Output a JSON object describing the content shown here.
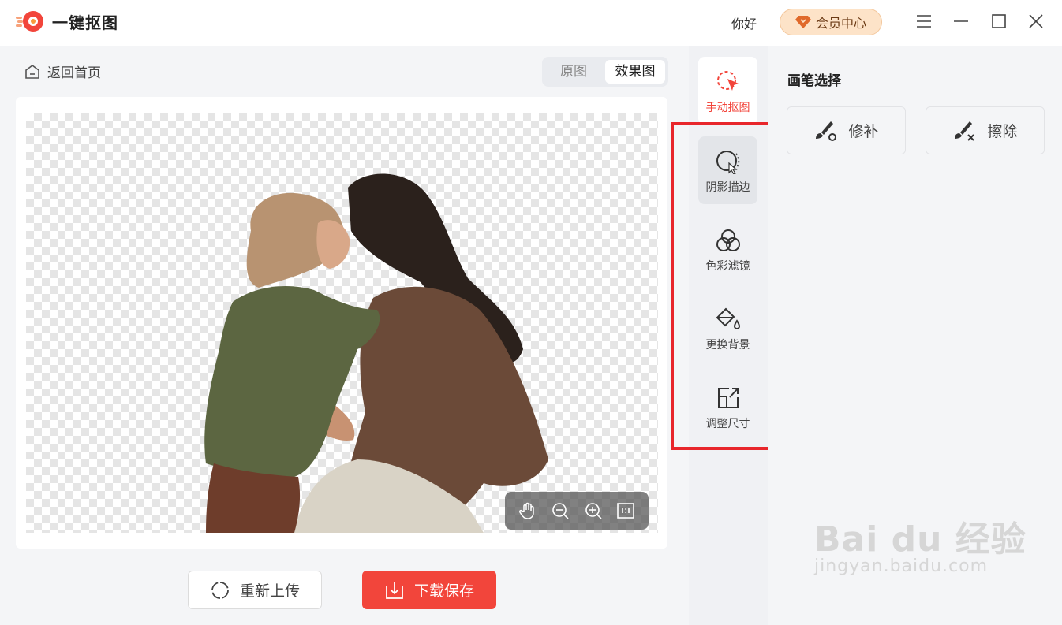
{
  "app": {
    "title": "一键抠图"
  },
  "header": {
    "greeting": "你好",
    "vip_label": "会员中心"
  },
  "window_controls": [
    "menu-icon",
    "minimize-icon",
    "maximize-icon",
    "close-icon"
  ],
  "toolbar": {
    "back_label": "返回首页",
    "view_tabs": [
      "原图",
      "效果图"
    ],
    "active_tab": "效果图"
  },
  "canvas": {
    "zoom_tools": [
      "hand-icon",
      "zoom-out-icon",
      "zoom-in-icon",
      "fit-icon"
    ]
  },
  "actions": {
    "reupload_label": "重新上传",
    "download_label": "下载保存"
  },
  "side_tools": [
    {
      "label": "手动抠图",
      "icon": "manual-cutout-icon",
      "active": true
    },
    {
      "label": "阴影描边",
      "icon": "shadow-stroke-icon"
    },
    {
      "label": "色彩滤镜",
      "icon": "color-filter-icon"
    },
    {
      "label": "更换背景",
      "icon": "paint-bucket-icon"
    },
    {
      "label": "调整尺寸",
      "icon": "resize-icon"
    }
  ],
  "panel": {
    "title": "画笔选择",
    "buttons": [
      {
        "label": "修补",
        "icon": "brush-repair-icon"
      },
      {
        "label": "擦除",
        "icon": "brush-erase-icon"
      }
    ]
  },
  "watermark": {
    "brand": "Bai du 经验",
    "url": "jingyan.baidu.com"
  },
  "colors": {
    "accent": "#f2453b",
    "highlight_box": "#e8262b",
    "vip_bg": "#fde3c8"
  }
}
